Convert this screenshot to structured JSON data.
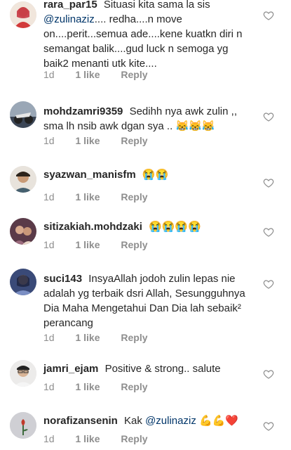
{
  "comments": [
    {
      "username": "rara_par15",
      "text_before": "Situasi kita sama la sis",
      "mention": "@zulinaziz",
      "text_after": ".... redha....n move on....perit...semua ade....kene kuatkn diri n semangat balik....gud luck n semoga yg baik2 menanti utk kite....",
      "time": "1d",
      "likes": "1 like",
      "reply": "Reply",
      "avatar_color": "#d23a3a"
    },
    {
      "username": "mohdzamri9359",
      "text": "Sedihh nya awk zulin ,, sma lh nsib awk dgan sya ..",
      "emoji": "😹😹😹",
      "time": "1d",
      "likes": "1 like",
      "reply": "Reply",
      "avatar_color": "#5b6a7c"
    },
    {
      "username": "syazwan_manisfm",
      "text": "",
      "emoji": "😭😭",
      "time": "1d",
      "likes": "1 like",
      "reply": "Reply",
      "avatar_color": "#8a6f55"
    },
    {
      "username": "sitizakiah.mohdzaki",
      "text": "",
      "emoji": "😭😭😭😭",
      "time": "1d",
      "likes": "1 like",
      "reply": "Reply",
      "avatar_color": "#7a4a5a"
    },
    {
      "username": "suci143",
      "text": "InsyaAllah jodoh zulin lepas nie adalah yg terbaik dsri Allah, Sesungguhnya Dia Maha Mengetahui Dan Dia lah sebaik² perancang",
      "time": "1d",
      "likes": "1 like",
      "reply": "Reply",
      "avatar_color": "#4a5a8a"
    },
    {
      "username": "jamri_ejam",
      "text": "Positive & strong.. salute",
      "time": "1d",
      "likes": "1 like",
      "reply": "Reply",
      "avatar_color": "#c9b8a8"
    },
    {
      "username": "norafizansenin",
      "text_before": "Kak",
      "mention": "@zulinaziz",
      "emoji": "💪💪❤️",
      "time": "1d",
      "likes": "1 like",
      "reply": "Reply",
      "avatar_color": "#b8b8c0"
    }
  ],
  "icons": {
    "like": "heart-outline-icon"
  }
}
